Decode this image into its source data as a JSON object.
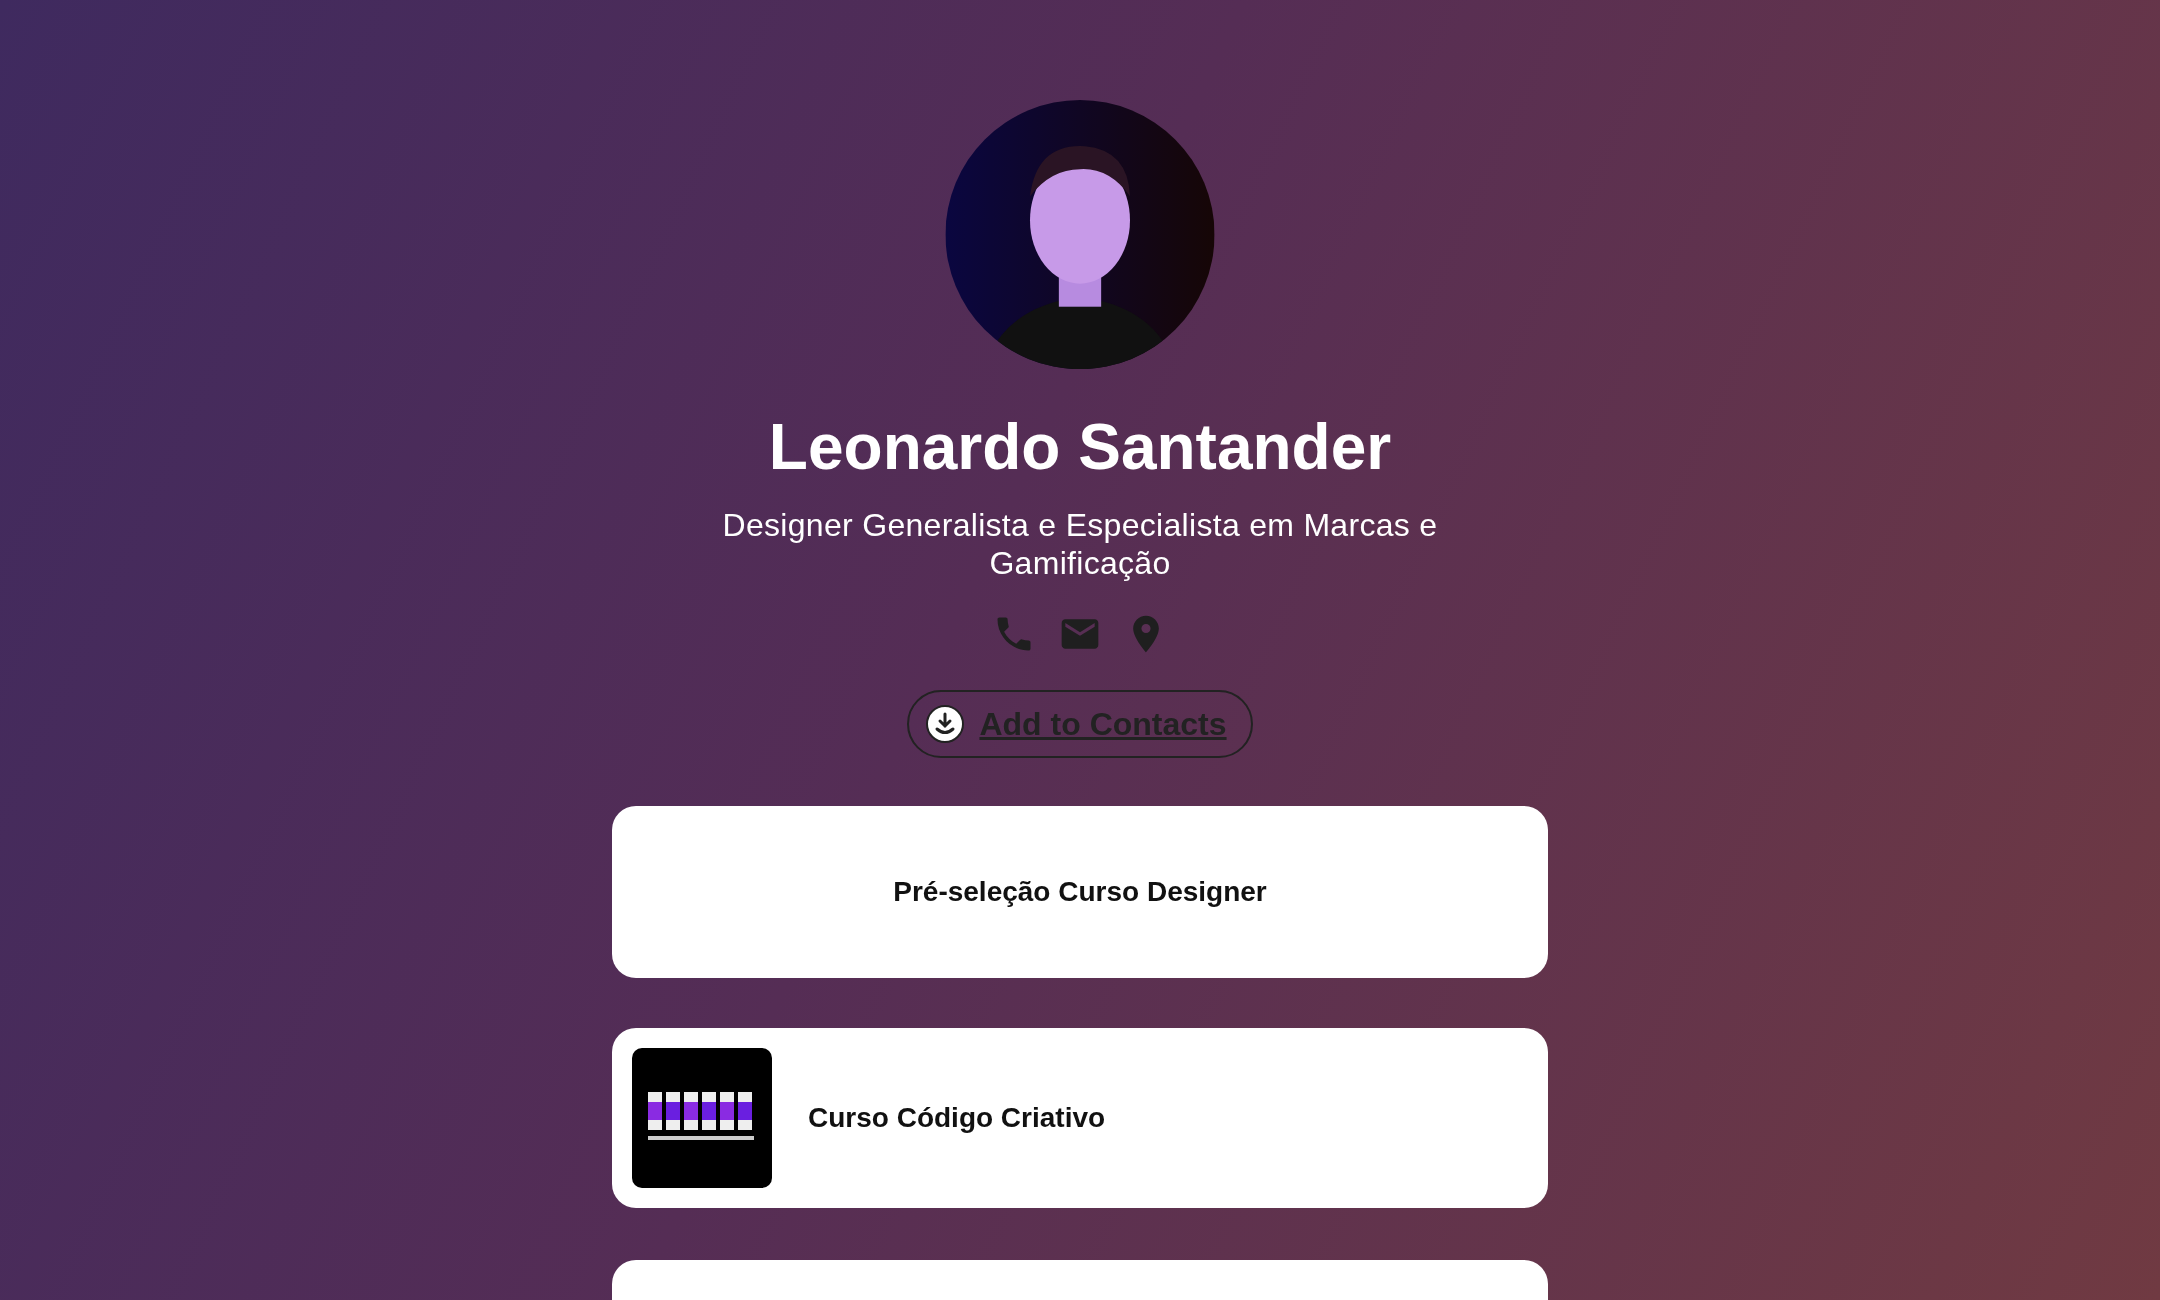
{
  "profile": {
    "name": "Leonardo Santander",
    "bio": "Designer Generalista e Especialista em Marcas e Gamificação"
  },
  "contacts": [
    {
      "kind": "phone"
    },
    {
      "kind": "email"
    },
    {
      "kind": "location"
    }
  ],
  "add_contact_button": {
    "label": "Add to Contacts"
  },
  "links": [
    {
      "kind": "text",
      "title": "Pré-seleção Curso Designer"
    },
    {
      "kind": "thumbnail",
      "title": "Curso Código Criativo"
    }
  ]
}
